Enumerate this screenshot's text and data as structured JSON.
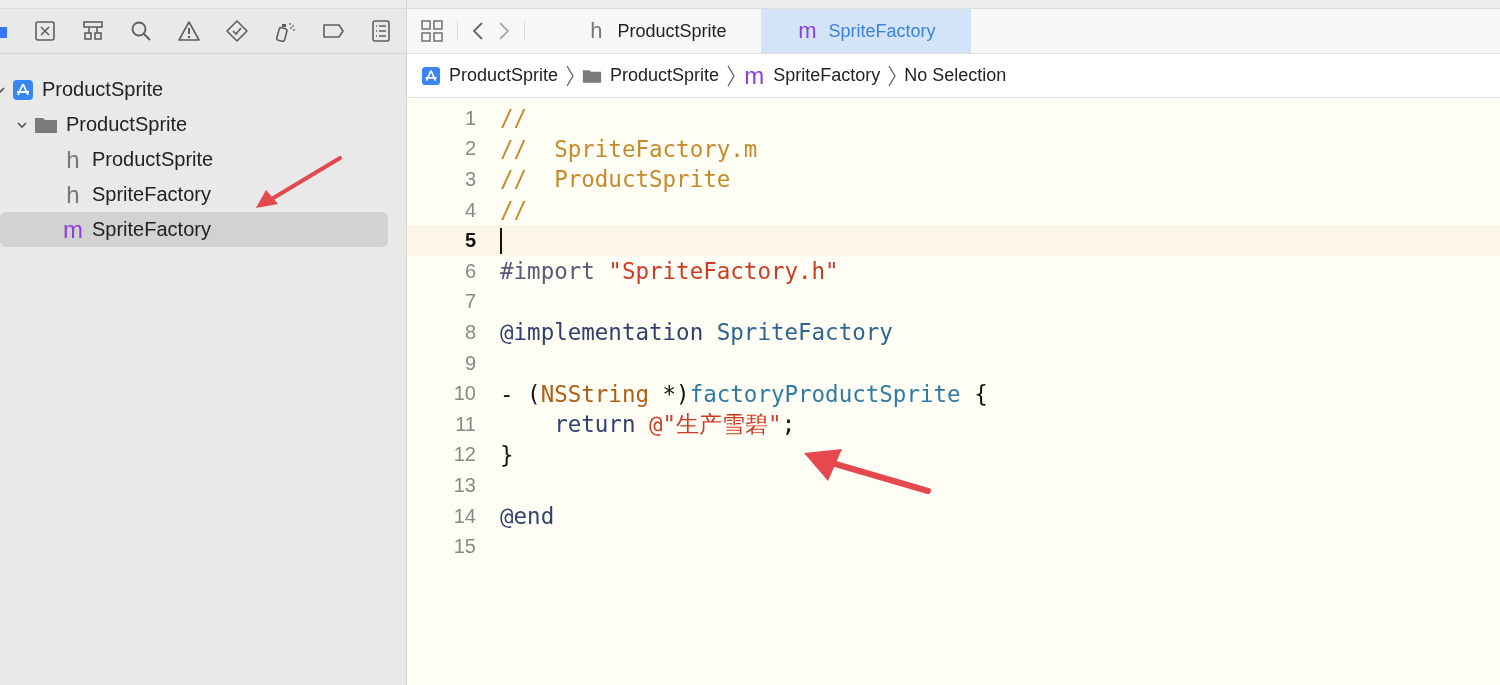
{
  "navigator_tabs": [
    {
      "kind": "folder",
      "selected": true
    },
    {
      "kind": "source-control",
      "selected": false
    },
    {
      "kind": "hierarchy",
      "selected": false
    },
    {
      "kind": "search",
      "selected": false
    },
    {
      "kind": "warning",
      "selected": false
    },
    {
      "kind": "test",
      "selected": false
    },
    {
      "kind": "debug",
      "selected": false
    },
    {
      "kind": "breakpoint",
      "selected": false
    },
    {
      "kind": "report",
      "selected": false
    }
  ],
  "tree": [
    {
      "kind": "project",
      "name": "ProductSprite",
      "selected": false,
      "expanded": true,
      "children": [
        {
          "kind": "folder",
          "name": "ProductSprite",
          "selected": false,
          "expanded": true,
          "children": [
            {
              "kind": "header",
              "icon": "h",
              "name": "ProductSprite",
              "selected": false
            },
            {
              "kind": "header",
              "icon": "h",
              "name": "SpriteFactory",
              "selected": false
            },
            {
              "kind": "impl",
              "icon": "m",
              "name": "SpriteFactory",
              "selected": true
            }
          ]
        }
      ]
    }
  ],
  "editor_tabs": [
    {
      "kind": "header",
      "icon": "h",
      "label": "ProductSprite",
      "selected": false
    },
    {
      "kind": "impl",
      "icon": "m",
      "label": "SpriteFactory",
      "selected": true
    }
  ],
  "breadcrumb": [
    {
      "kind": "project",
      "label": "ProductSprite"
    },
    {
      "kind": "folder",
      "label": "ProductSprite"
    },
    {
      "kind": "impl",
      "icon": "m",
      "label": "SpriteFactory"
    },
    {
      "kind": "plain",
      "label": "No Selection"
    }
  ],
  "code_lines": [
    {
      "number": "1",
      "current": false,
      "tokens": [
        {
          "kind": "comment",
          "text": "//"
        }
      ]
    },
    {
      "number": "2",
      "current": false,
      "tokens": [
        {
          "kind": "comment",
          "text": "//  SpriteFactory.m"
        }
      ]
    },
    {
      "number": "3",
      "current": false,
      "tokens": [
        {
          "kind": "comment",
          "text": "//  ProductSprite"
        }
      ]
    },
    {
      "number": "4",
      "current": false,
      "tokens": [
        {
          "kind": "comment",
          "text": "//"
        }
      ]
    },
    {
      "number": "5",
      "current": true
    },
    {
      "number": "6",
      "current": false,
      "tokens": [
        {
          "kind": "directive",
          "text": "#import"
        },
        {
          "kind": "string",
          "text": " \"SpriteFactory.h\""
        }
      ]
    },
    {
      "number": "7",
      "current": false
    },
    {
      "number": "8",
      "current": false,
      "tokens": [
        {
          "kind": "keyword",
          "text": "@implementation"
        },
        {
          "kind": "classname",
          "text": " SpriteFactory"
        }
      ]
    },
    {
      "number": "9",
      "current": false
    },
    {
      "number": "10",
      "current": false,
      "tokens": [
        {
          "kind": "plain",
          "text": "- ("
        },
        {
          "kind": "type",
          "text": "NSString"
        },
        {
          "kind": "plain",
          "text": " *)"
        },
        {
          "kind": "func",
          "text": "factoryProductSprite"
        },
        {
          "kind": "plain",
          "text": " {"
        }
      ]
    },
    {
      "number": "11",
      "current": false,
      "tokens": [
        {
          "kind": "keyword",
          "text": "    return"
        },
        {
          "kind": "string",
          "text": " @\"生产雪碧\""
        },
        {
          "kind": "plain",
          "text": ";"
        }
      ]
    },
    {
      "number": "12",
      "current": false,
      "tokens": [
        {
          "kind": "plain",
          "text": "}"
        }
      ]
    },
    {
      "number": "13",
      "current": false
    },
    {
      "number": "14",
      "current": false,
      "tokens": [
        {
          "kind": "keyword",
          "text": "@end"
        }
      ]
    },
    {
      "number": "15",
      "current": false
    }
  ]
}
